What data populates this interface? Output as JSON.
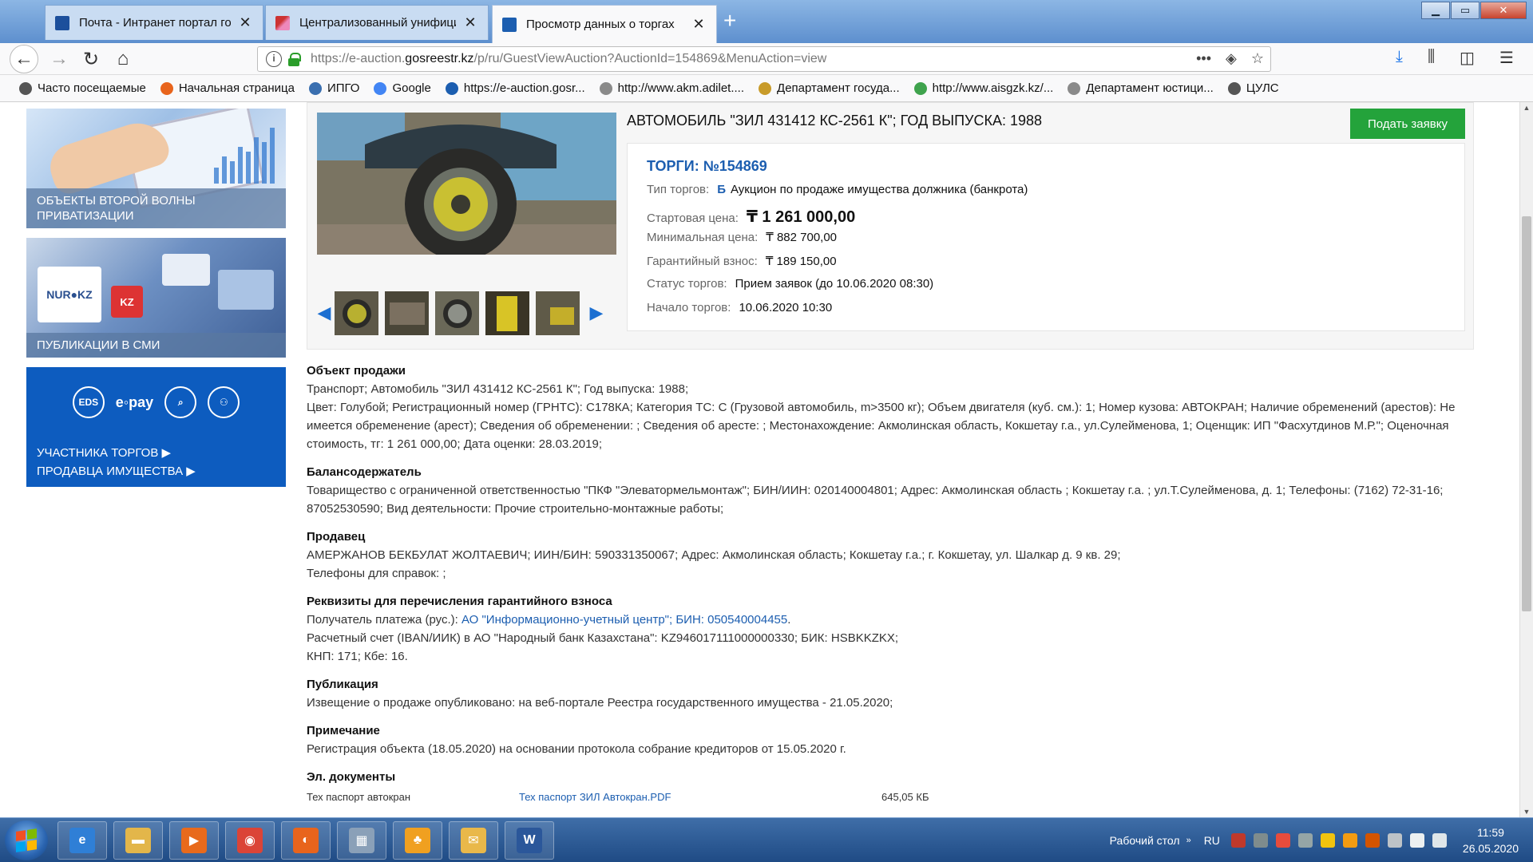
{
  "browser": {
    "tabs": [
      {
        "title": "Почта - Интранет портал гос",
        "active": false
      },
      {
        "title": "Централизованный унифици",
        "active": false
      },
      {
        "title": "Просмотр данных о торгах",
        "active": true
      }
    ],
    "new_tab": "+",
    "url_prefix": "https://e-auction.",
    "url_domain": "gosreestr.kz",
    "url_path": "/p/ru/GuestViewAuction?AuctionId=154869&MenuAction=view",
    "bookmarks": [
      {
        "label": "Часто посещаемые",
        "icon": "gear-icon",
        "color": "#555555"
      },
      {
        "label": "Начальная страница",
        "icon": "firefox-icon",
        "color": "#e8641c"
      },
      {
        "label": "ИПГО",
        "icon": "ipgo-icon",
        "color": "#3a6fb0"
      },
      {
        "label": "Google",
        "icon": "google-icon",
        "color": "#4285f4"
      },
      {
        "label": "https://e-auction.gosr...",
        "icon": "gosreestr-icon",
        "color": "#1c5eb0"
      },
      {
        "label": "http://www.akm.adilet....",
        "icon": "adilet-icon",
        "color": "#8a8a8a"
      },
      {
        "label": "Департамент госуда...",
        "icon": "emblem-icon",
        "color": "#c89b2a"
      },
      {
        "label": "http://www.aisgzk.kz/...",
        "icon": "aisgzk-icon",
        "color": "#3fa34d"
      },
      {
        "label": "Департамент юстици...",
        "icon": "justice-icon",
        "color": "#8a8a8a"
      },
      {
        "label": "ЦУЛС",
        "icon": "globe-icon",
        "color": "#555555"
      }
    ]
  },
  "sidebar": {
    "banner1_caption": "ОБЪЕКТЫ ВТОРОЙ ВОЛНЫ ПРИВАТИЗАЦИИ",
    "banner2_caption": "ПУБЛИКАЦИИ В СМИ",
    "banner2_logo": "NUR●KZ",
    "banner2_logo2": "KZ",
    "banner3_logo": "e◦pay",
    "banner3_eds": "EDS",
    "banner3_line1": "УЧАСТНИКА ТОРГОВ ▶",
    "banner3_line2": "ПРОДАВЦА ИМУЩЕСТВА ▶"
  },
  "lot": {
    "title": "АВТОМОБИЛЬ \"ЗИЛ 431412 КС-2561 К\"; ГОД ВЫПУСКА: 1988",
    "apply_label": "Подать заявку",
    "auction_no": "ТОРГИ: №154869",
    "type_label": "Тип торгов:",
    "type_badge": "Б",
    "type_value": "Аукцион по продаже имущества должника (банкрота)",
    "start_label": "Стартовая цена:",
    "start_value": "₸ 1 261 000,00",
    "min_label": "Минимальная цена:",
    "min_value": "₸ 882 700,00",
    "deposit_label": "Гарантийный взнос:",
    "deposit_value": "₸ 189 150,00",
    "status_label": "Статус торгов:",
    "status_value": "Прием заявок (до 10.06.2020 08:30)",
    "begin_label": "Начало торгов:",
    "begin_value": "10.06.2020 10:30"
  },
  "sections": {
    "object_title": "Объект продажи",
    "object_l1": "Транспорт; Автомобиль \"ЗИЛ 431412 КС-2561 К\"; Год выпуска: 1988;",
    "object_l2": "Цвет: Голубой; Регистрационный номер (ГРНТС): С178КА; Категория ТС: С (Грузовой автомобиль, m>3500 кг); Объем двигателя (куб. см.): 1; Номер кузова: АВТОКРАН; Наличие обременений (арестов): Не имеется обременение (арест); Сведения об обременении: ; Сведения об аресте: ; Местонахождение: Акмолинская область, Кокшетау г.а., ул.Сулейменова, 1; Оценщик: ИП \"Фасхутдинов М.Р.\"; Оценочная стоимость, тг: 1 261 000,00; Дата оценки: 28.03.2019;",
    "holder_title": "Балансодержатель",
    "holder_text": "Товарищество с ограниченной ответственностью \"ПКФ \"Элеватормельмонтаж\"; БИН/ИИН: 020140004801; Адрес: Акмолинская область ; Кокшетау г.а. ; ул.Т.Сулейменова, д. 1; Телефоны: (7162) 72-31-16; 87052530590; Вид деятельности: Прочие строительно-монтажные работы;",
    "seller_title": "Продавец",
    "seller_l1": "АМЕРЖАНОВ БЕКБУЛАТ ЖОЛТАЕВИЧ; ИИН/БИН: 590331350067;  Адрес: Акмолинская область; Кокшетау г.а.; г. Кокшетау, ул. Шалкар д. 9 кв. 29;",
    "seller_l2": "Телефоны для справок: ;",
    "req_title": "Реквизиты для перечисления гарантийного взноса",
    "req_l1_prefix": "Получатель платежа (рус.): ",
    "req_l1_link": "АО \"Информационно-учетный центр\"; БИН: 050540004455",
    "req_l1_suffix": ".",
    "req_l2": "Расчетный счет (IBAN/ИИК) в АО \"Народный банк Казахстана\": KZ946017111000000330; БИК: HSBKKZKX;",
    "req_l3": "КНП: 171; Кбе: 16.",
    "pub_title": "Публикация",
    "pub_text": "Извещение о продаже опубликовано: на веб-портале Реестра государственного имущества - 21.05.2020;",
    "note_title": "Примечание",
    "note_text": "Регистрация объекта (18.05.2020) на основании протокола собрание кредиторов от 15.05.2020 г.",
    "docs_title": "Эл. документы",
    "doc_name": "Тех паспорт автокран",
    "doc_file": "Тех паспорт ЗИЛ Автокран.PDF",
    "doc_size": "645,05 КБ"
  },
  "taskbar": {
    "desktop_label": "Рабочий стол",
    "lang": "RU",
    "time": "11:59",
    "date": "26.05.2020",
    "apps": [
      {
        "icon": "ie-icon",
        "color": "#2f7fd6",
        "glyph": "e"
      },
      {
        "icon": "explorer-icon",
        "color": "#e3b64a",
        "glyph": "▬"
      },
      {
        "icon": "media-player-icon",
        "color": "#e86a1c",
        "glyph": "▶"
      },
      {
        "icon": "chrome-icon",
        "color": "#db4437",
        "glyph": "◉"
      },
      {
        "icon": "firefox-icon",
        "color": "#e8641c",
        "glyph": "◐"
      },
      {
        "icon": "calculator-icon",
        "color": "#8aa0b8",
        "glyph": "▦"
      },
      {
        "icon": "people-icon",
        "color": "#f0a020",
        "glyph": "♣"
      },
      {
        "icon": "mail-icon",
        "color": "#e9b84a",
        "glyph": "✉"
      },
      {
        "icon": "word-icon",
        "color": "#2b579a",
        "glyph": "W"
      }
    ]
  }
}
